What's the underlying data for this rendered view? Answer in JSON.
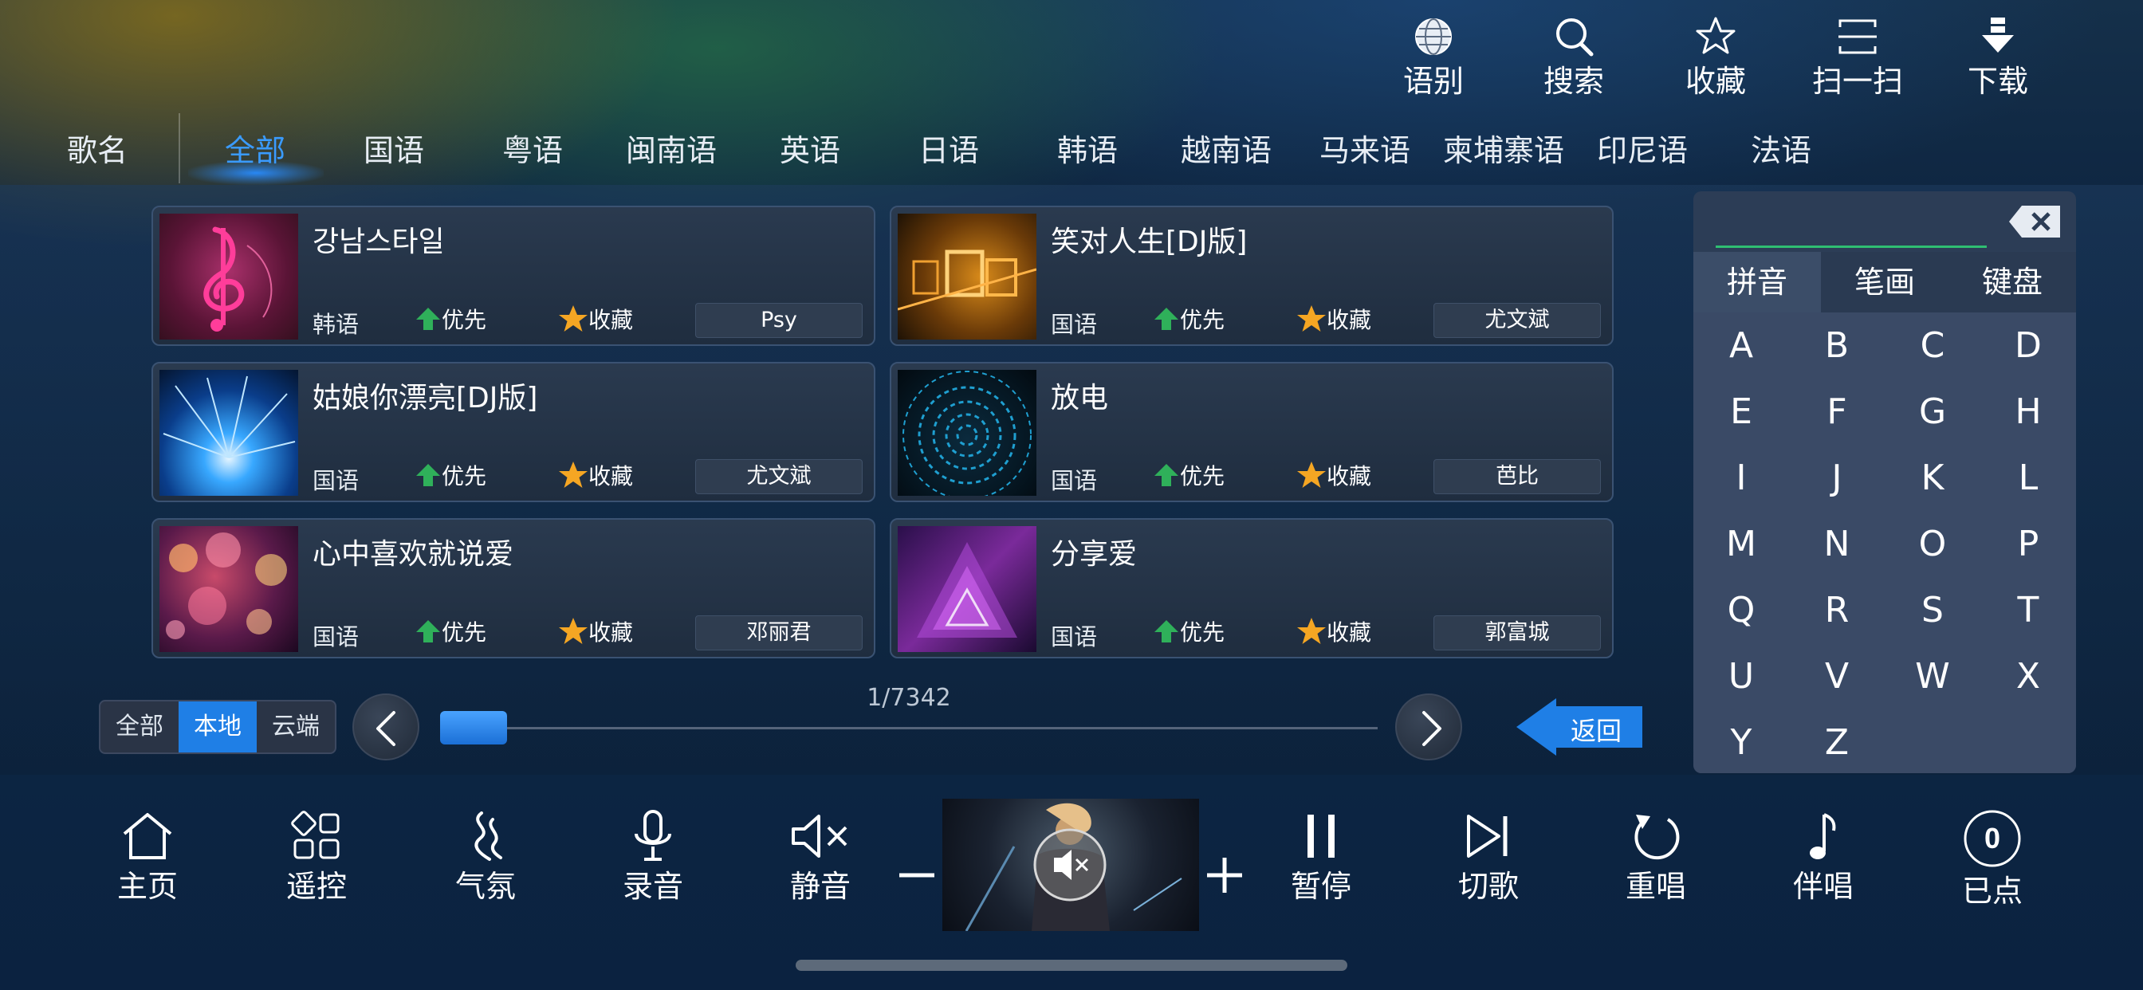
{
  "toolbar": {
    "items": [
      {
        "label": "语别",
        "icon": "globe-icon"
      },
      {
        "label": "搜索",
        "icon": "search-icon"
      },
      {
        "label": "收藏",
        "icon": "star-outline-icon"
      },
      {
        "label": "扫一扫",
        "icon": "scan-icon"
      },
      {
        "label": "下载",
        "icon": "download-icon"
      }
    ]
  },
  "languages": {
    "title": "歌名",
    "tabs": [
      "全部",
      "国语",
      "粤语",
      "闽南语",
      "英语",
      "日语",
      "韩语",
      "越南语",
      "马来语",
      "柬埔寨语",
      "印尼语",
      "法语"
    ],
    "active": "全部"
  },
  "songs": [
    {
      "title": "강남스타일",
      "lang": "韩语",
      "priority": "优先",
      "favorite": "收藏",
      "singer": "Psy"
    },
    {
      "title": "笑对人生[DJ版]",
      "lang": "国语",
      "priority": "优先",
      "favorite": "收藏",
      "singer": "尤文斌"
    },
    {
      "title": "姑娘你漂亮[DJ版]",
      "lang": "国语",
      "priority": "优先",
      "favorite": "收藏",
      "singer": "尤文斌"
    },
    {
      "title": "放电",
      "lang": "国语",
      "priority": "优先",
      "favorite": "收藏",
      "singer": "芭比"
    },
    {
      "title": "心中喜欢就说爱",
      "lang": "国语",
      "priority": "优先",
      "favorite": "收藏",
      "singer": "邓丽君"
    },
    {
      "title": "分享爱",
      "lang": "国语",
      "priority": "优先",
      "favorite": "收藏",
      "singer": "郭富城"
    }
  ],
  "source_filter": {
    "options": [
      "全部",
      "本地",
      "云端"
    ],
    "active": "本地"
  },
  "pagination": {
    "page_text": "1/7342",
    "current": 1,
    "total": 7342,
    "back_label": "返回"
  },
  "keyboard": {
    "input_value": "",
    "modes": [
      "拼音",
      "笔画",
      "键盘"
    ],
    "active_mode": "拼音",
    "keys": [
      "A",
      "B",
      "C",
      "D",
      "E",
      "F",
      "G",
      "H",
      "I",
      "J",
      "K",
      "L",
      "M",
      "N",
      "O",
      "P",
      "Q",
      "R",
      "S",
      "T",
      "U",
      "V",
      "W",
      "X",
      "Y",
      "Z"
    ]
  },
  "controls": {
    "home": "主页",
    "remote": "遥控",
    "atmosphere": "气氛",
    "record": "录音",
    "mute": "静音",
    "pause": "暂停",
    "next": "切歌",
    "replay": "重唱",
    "accompany": "伴唱",
    "queued": "已点",
    "queued_count": "0",
    "vol_down": "−",
    "vol_up": "+"
  },
  "colors": {
    "accent": "#1f7fe6",
    "active_tab": "#3a9bff",
    "priority_green": "#2fb05a",
    "favorite_gold": "#f5a623"
  }
}
